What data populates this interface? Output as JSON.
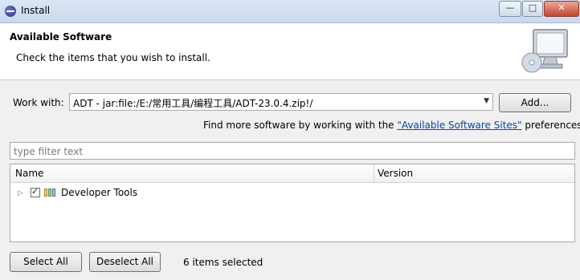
{
  "window": {
    "title": "Install",
    "controls": {
      "minimize": "—",
      "maximize": "□",
      "close": "✕"
    }
  },
  "banner": {
    "title": "Available Software",
    "subtitle": "Check the items that you wish to install."
  },
  "work_with": {
    "label": "Work with:",
    "value": "ADT - jar:file:/E:/常用工具/编程工具/ADT-23.0.4.zip!/",
    "add_button": "Add..."
  },
  "find_more": {
    "prefix": "Find more software by working with the ",
    "link": "\"Available Software Sites\"",
    "suffix": " preferences."
  },
  "filter": {
    "placeholder": "type filter text"
  },
  "tree": {
    "columns": [
      "Name",
      "Version"
    ],
    "rows": [
      {
        "label": "Developer Tools",
        "checked": true,
        "version": ""
      }
    ]
  },
  "footer": {
    "select_all": "Select All",
    "deselect_all": "Deselect All",
    "status": "6 items selected"
  },
  "icons": [
    "eclipse-icon",
    "computer-cd-icon",
    "expand-arrow-icon",
    "feature-group-icon",
    "dropdown-arrow-icon"
  ]
}
